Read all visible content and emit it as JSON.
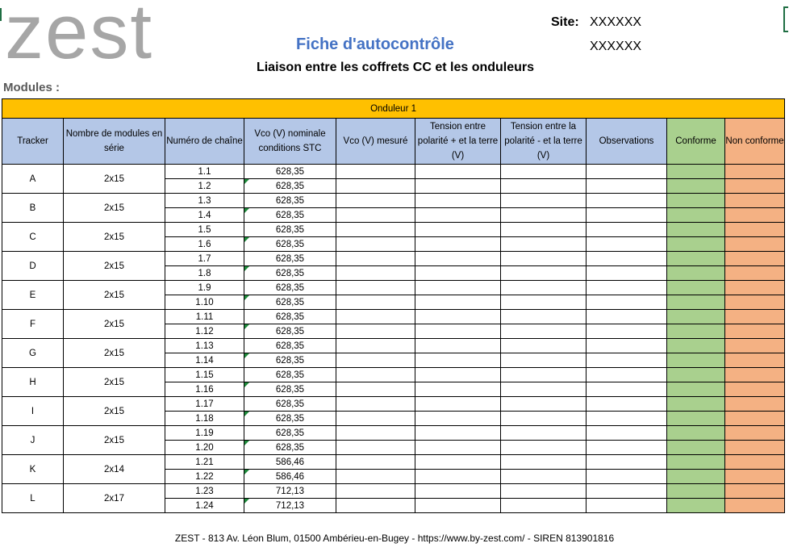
{
  "header": {
    "logo_text": "zest",
    "title": "Fiche d'autocontrôle",
    "subtitle": "Liaison entre les coffrets CC et les onduleurs",
    "site_label": "Site:",
    "site_value": "XXXXXX",
    "site_value2": "XXXXXX",
    "modules_label": "Modules  :"
  },
  "table": {
    "group_title": "Onduleur 1",
    "columns": [
      "Tracker",
      "Nombre de modules en série",
      "Numéro de chaîne",
      "Vco (V) nominale conditions STC",
      "Vco (V) mesuré",
      "Tension entre polarité + et la terre (V)",
      "Tension entre la polarité - et la terre (V)",
      "Observations",
      "Conforme",
      "Non conforme"
    ],
    "trackers": [
      {
        "name": "A",
        "modules": "2x15",
        "chains": [
          {
            "num": "1.1",
            "vco": "628,35"
          },
          {
            "num": "1.2",
            "vco": "628,35"
          }
        ]
      },
      {
        "name": "B",
        "modules": "2x15",
        "chains": [
          {
            "num": "1.3",
            "vco": "628,35"
          },
          {
            "num": "1.4",
            "vco": "628,35"
          }
        ]
      },
      {
        "name": "C",
        "modules": "2x15",
        "chains": [
          {
            "num": "1.5",
            "vco": "628,35"
          },
          {
            "num": "1.6",
            "vco": "628,35"
          }
        ]
      },
      {
        "name": "D",
        "modules": "2x15",
        "chains": [
          {
            "num": "1.7",
            "vco": "628,35"
          },
          {
            "num": "1.8",
            "vco": "628,35"
          }
        ]
      },
      {
        "name": "E",
        "modules": "2x15",
        "chains": [
          {
            "num": "1.9",
            "vco": "628,35"
          },
          {
            "num": "1.10",
            "vco": "628,35"
          }
        ]
      },
      {
        "name": "F",
        "modules": "2x15",
        "chains": [
          {
            "num": "1.11",
            "vco": "628,35"
          },
          {
            "num": "1.12",
            "vco": "628,35"
          }
        ]
      },
      {
        "name": "G",
        "modules": "2x15",
        "chains": [
          {
            "num": "1.13",
            "vco": "628,35"
          },
          {
            "num": "1.14",
            "vco": "628,35"
          }
        ]
      },
      {
        "name": "H",
        "modules": "2x15",
        "chains": [
          {
            "num": "1.15",
            "vco": "628,35"
          },
          {
            "num": "1.16",
            "vco": "628,35"
          }
        ]
      },
      {
        "name": "I",
        "modules": "2x15",
        "chains": [
          {
            "num": "1.17",
            "vco": "628,35"
          },
          {
            "num": "1.18",
            "vco": "628,35"
          }
        ]
      },
      {
        "name": "J",
        "modules": "2x15",
        "chains": [
          {
            "num": "1.19",
            "vco": "628,35"
          },
          {
            "num": "1.20",
            "vco": "628,35"
          }
        ]
      },
      {
        "name": "K",
        "modules": "2x14",
        "chains": [
          {
            "num": "1.21",
            "vco": "586,46"
          },
          {
            "num": "1.22",
            "vco": "586,46"
          }
        ]
      },
      {
        "name": "L",
        "modules": "2x17",
        "chains": [
          {
            "num": "1.23",
            "vco": "712,13"
          },
          {
            "num": "1.24",
            "vco": "712,13"
          }
        ]
      }
    ]
  },
  "footer": {
    "text": "ZEST - 813 Av. Léon Blum, 01500 Ambérieu-en-Bugey - https://www.by-zest.com/ - SIREN 813901816"
  },
  "colors": {
    "header_fill": "#b4c7e7",
    "group_fill": "#ffc000",
    "conforme_fill": "#a9d08e",
    "non_conforme_fill": "#f4b183",
    "title_color": "#4472c4"
  }
}
